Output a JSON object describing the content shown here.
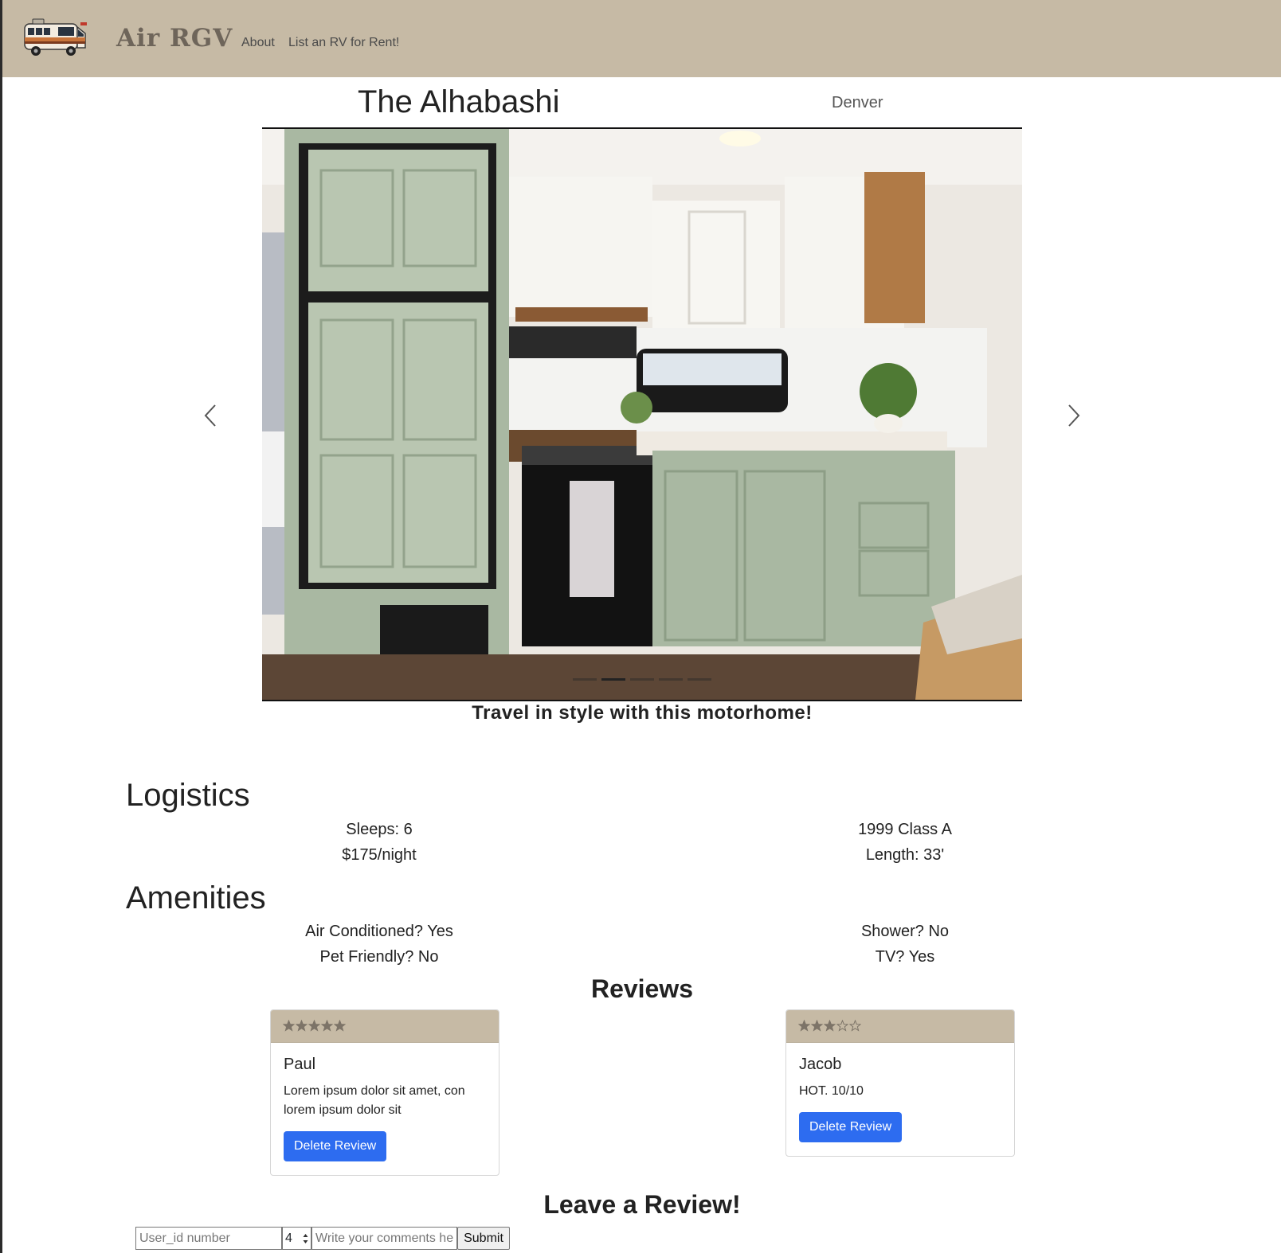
{
  "nav": {
    "brand": "Air RGV",
    "links": [
      "About",
      "List an RV for Rent!"
    ]
  },
  "listing": {
    "name": "The Alhabashi",
    "city": "Denver",
    "tagline": "Travel in style with this motorhome!",
    "carousel": {
      "slides": 5,
      "active_slide": 2
    }
  },
  "logistics": {
    "heading": "Logistics",
    "sleeps": "Sleeps: 6",
    "price": "$175/night",
    "year_class": "1999 Class A",
    "length": "Length: 33'"
  },
  "amenities": {
    "heading": "Amenities",
    "ac": "Air Conditioned? Yes",
    "pets": "Pet Friendly? No",
    "shower": "Shower? No",
    "tv": "TV? Yes"
  },
  "reviews": {
    "heading": "Reviews",
    "items": [
      {
        "name": "Paul",
        "rating": 5,
        "comment": "Lorem ipsum dolor sit amet, con lorem ipsum dolor sit",
        "delete_label": "Delete Review"
      },
      {
        "name": "Jacob",
        "rating": 3,
        "comment": "HOT. 10/10",
        "delete_label": "Delete Review"
      }
    ]
  },
  "review_form": {
    "heading": "Leave a Review!",
    "user_placeholder": "User_id number",
    "rating_value": "4",
    "comment_placeholder": "Write your comments here",
    "submit_label": "Submit"
  },
  "colors": {
    "navbar": "#c6baa5",
    "brand_text": "#6e655a",
    "button_primary": "#2d6cf0",
    "star_fill": "#7d7468"
  }
}
